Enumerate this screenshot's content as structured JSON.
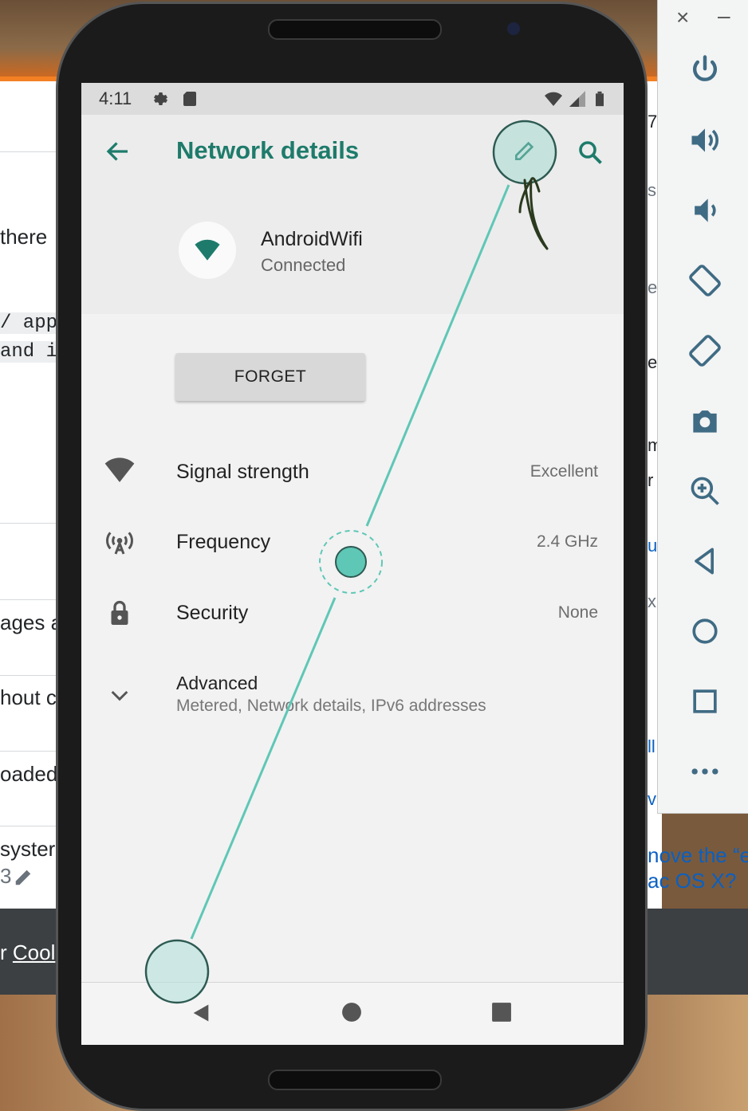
{
  "background": {
    "text_fragments": [
      "there",
      "ages a",
      "hout c",
      "oaded",
      "syster",
      "3"
    ],
    "code_lines": [
      "/ app",
      "and i"
    ],
    "right_fragments": [
      "7",
      "s",
      "e",
      "ev",
      "m",
      "r",
      "u",
      "x",
      "ll",
      "va"
    ],
    "right_links": [
      "nove the “e",
      "ac OS X?"
    ],
    "footer_prefix": "r ",
    "footer_link": "Cool",
    "accent": "#f48024",
    "link_color": "#0a60c2"
  },
  "toolbar": {
    "window_controls": [
      "×",
      "–"
    ],
    "icons": [
      "power-icon",
      "volume-up-icon",
      "volume-down-icon",
      "rotate-left-icon",
      "rotate-right-icon",
      "camera-icon",
      "zoom-in-icon",
      "back-icon",
      "home-icon",
      "overview-icon",
      "more-icon"
    ]
  },
  "statusbar": {
    "time": "4:11",
    "icons": [
      "settings-icon",
      "sd-card-icon",
      "wifi-icon",
      "cell-signal-icon",
      "battery-icon"
    ]
  },
  "appbar": {
    "title": "Network details",
    "actions": [
      "edit-icon",
      "search-icon"
    ],
    "accent": "#1e7b6b"
  },
  "network": {
    "name": "AndroidWifi",
    "status": "Connected"
  },
  "forget_button": "FORGET",
  "details": [
    {
      "label": "Signal strength",
      "value": "Excellent",
      "icon": "wifi-signal-icon"
    },
    {
      "label": "Frequency",
      "value": "2.4 GHz",
      "icon": "antenna-icon"
    },
    {
      "label": "Security",
      "value": "None",
      "icon": "lock-icon"
    }
  ],
  "advanced": {
    "label": "Advanced",
    "summary": "Metered, Network details, IPv6 addresses",
    "icon": "chevron-down-icon"
  },
  "navbar": [
    "back-icon",
    "home-icon",
    "recents-icon"
  ],
  "gesture": {
    "color": "#5fc7b6"
  }
}
